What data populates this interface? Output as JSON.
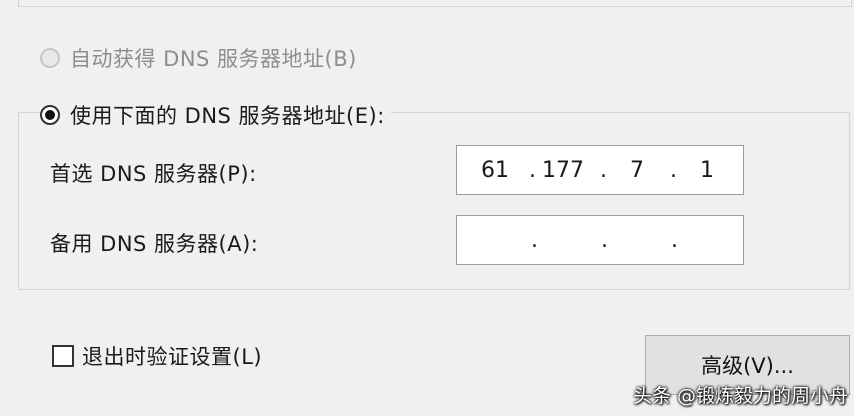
{
  "auto_dns": {
    "label": "自动获得 DNS 服务器地址(B)",
    "selected": false,
    "enabled": false
  },
  "manual_dns": {
    "label": "使用下面的 DNS 服务器地址(E):",
    "selected": true
  },
  "preferred_dns": {
    "label": "首选 DNS 服务器(P):",
    "octets": [
      "61",
      "177",
      "7",
      "1"
    ]
  },
  "alternate_dns": {
    "label": "备用 DNS 服务器(A):",
    "octets": [
      "",
      "",
      "",
      ""
    ]
  },
  "separator": ".",
  "validate_on_exit": {
    "label": "退出时验证设置(L)",
    "checked": false
  },
  "advanced_button": {
    "label": "高级(V)..."
  },
  "watermark": "头条 @锻炼毅力的周小舟"
}
